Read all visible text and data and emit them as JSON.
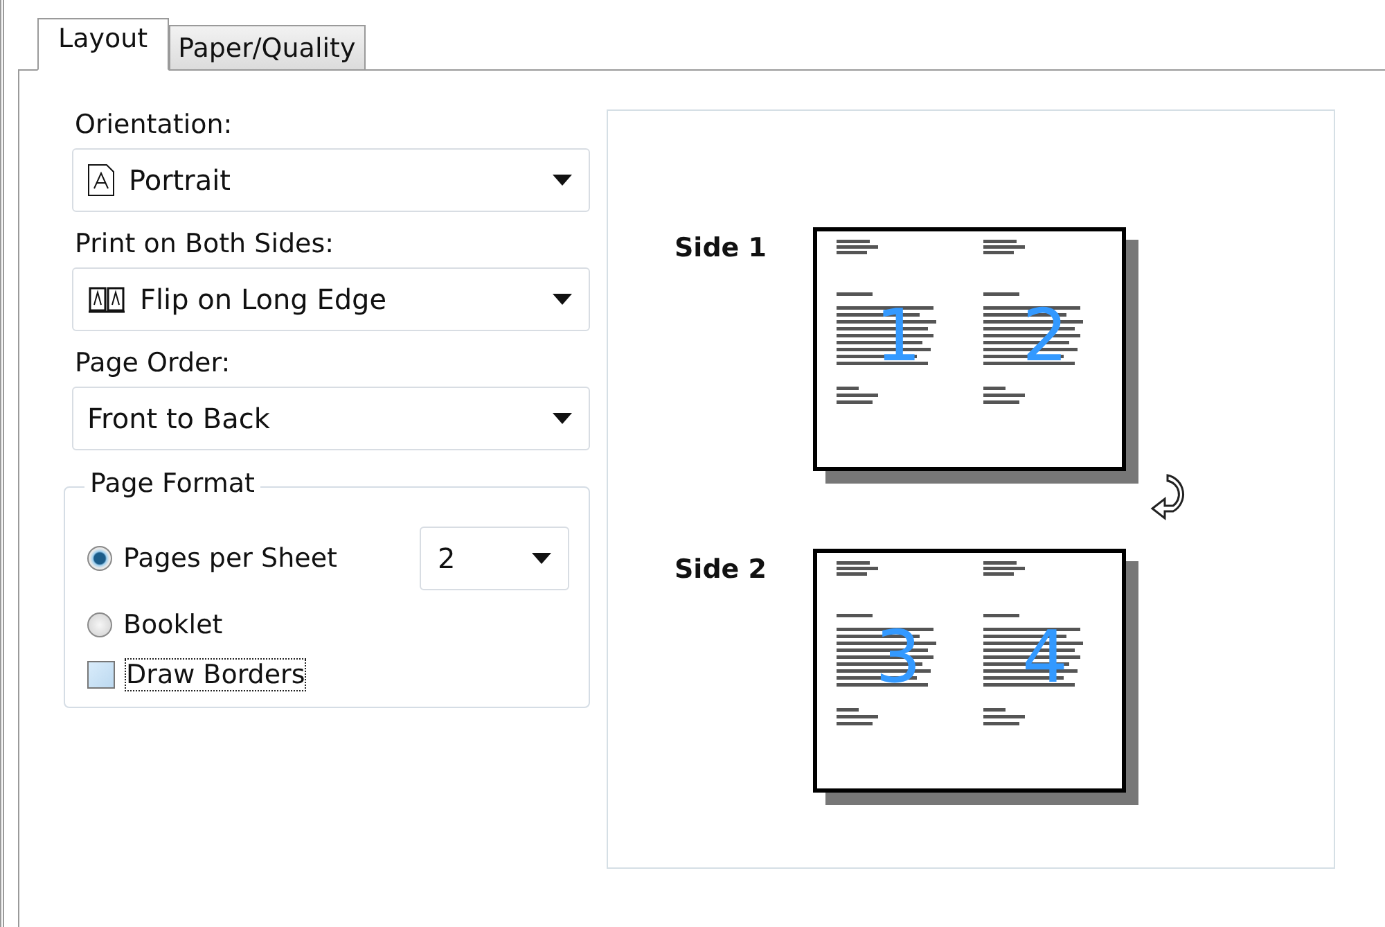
{
  "tabs": [
    {
      "label": "Layout",
      "selected": true
    },
    {
      "label": "Paper/Quality",
      "selected": false
    }
  ],
  "orientation": {
    "label": "Orientation:",
    "value": "Portrait"
  },
  "print_on_both_sides": {
    "label": "Print on Both Sides:",
    "value": "Flip on Long Edge"
  },
  "page_order": {
    "label": "Page Order:",
    "value": "Front to Back"
  },
  "page_format": {
    "title": "Page Format",
    "options": [
      {
        "label": "Pages per Sheet",
        "selected": true
      },
      {
        "label": "Booklet",
        "selected": false
      }
    ],
    "pages_per_sheet": "2",
    "draw_borders": {
      "label": "Draw Borders",
      "checked": false
    }
  },
  "preview": {
    "sides": [
      {
        "label": "Side 1",
        "pages": [
          "1",
          "2"
        ]
      },
      {
        "label": "Side 2",
        "pages": [
          "3",
          "4"
        ]
      }
    ]
  }
}
